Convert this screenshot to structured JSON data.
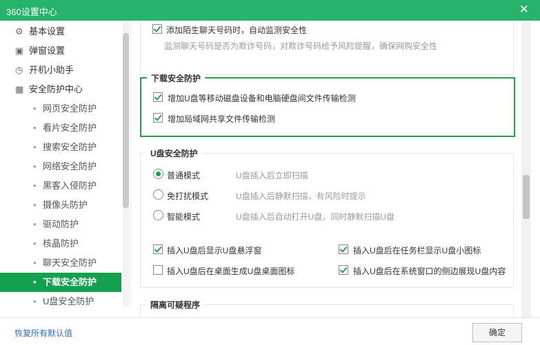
{
  "window": {
    "title": "360设置中心",
    "close_glyph": "✕"
  },
  "sidebar": {
    "items": [
      {
        "label": "基本设置",
        "icon": "gear-icon",
        "glyph": "⚙"
      },
      {
        "label": "弹窗设置",
        "icon": "window-icon",
        "glyph": "▣"
      },
      {
        "label": "开机小助手",
        "icon": "clock-icon",
        "glyph": "◷"
      },
      {
        "label": "安全防护中心",
        "icon": "grid-icon",
        "glyph": "▦"
      }
    ],
    "sub_items": [
      {
        "label": "网页安全防护"
      },
      {
        "label": "看片安全防护"
      },
      {
        "label": "搜索安全防护"
      },
      {
        "label": "网络安全防护"
      },
      {
        "label": "黑客入侵防护"
      },
      {
        "label": "摄像头防护"
      },
      {
        "label": "驱动防护"
      },
      {
        "label": "核晶防护"
      },
      {
        "label": "聊天安全防护"
      },
      {
        "label": "下载安全防护",
        "active": true
      },
      {
        "label": "U盘安全防护"
      }
    ],
    "dot_glyph": "•"
  },
  "chat_section": {
    "option_label": "添加陌生聊天号码时，自动监测安全性",
    "option_checked": true,
    "hint": "监测聊天号码是否为欺诈号码，对欺诈号码给予风险提醒，确保网购安全性"
  },
  "download_section": {
    "title": "下载安全防护",
    "options": [
      {
        "label": "增加U盘等移动磁盘设备和电脑硬盘间文件传输检测",
        "checked": true
      },
      {
        "label": "增加局域网共享文件传输检测",
        "checked": true
      }
    ]
  },
  "usb_section": {
    "title": "U盘安全防护",
    "modes": [
      {
        "label": "普通模式",
        "hint": "U盘插入后立即扫描",
        "selected": true
      },
      {
        "label": "免打扰模式",
        "hint": "U盘插入后静默扫描，有风险时提示",
        "selected": false
      },
      {
        "label": "智能模式",
        "hint": "U盘插入后自动打开U盘，同时静默扫描U盘",
        "selected": false
      }
    ],
    "options": [
      {
        "label": "插入U盘后显示U盘悬浮窗",
        "checked": true
      },
      {
        "label": "插入U盘后在任务栏显示U盘小图标",
        "checked": true
      },
      {
        "label": "插入U盘后在桌面生成U盘桌面图标",
        "checked": false
      },
      {
        "label": "插入U盘后在系统窗口的侧边展现U盘内容",
        "checked": true
      }
    ]
  },
  "isolation_section": {
    "title": "隔离可疑程序"
  },
  "footer": {
    "restore_label": "恢复所有默认值",
    "ok_label": "确定"
  }
}
